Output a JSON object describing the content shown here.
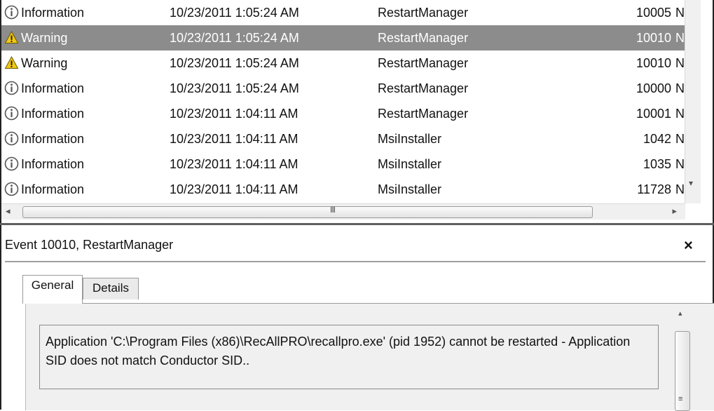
{
  "events": [
    {
      "level": "Information",
      "level_icon": "info-icon",
      "date": "10/23/2011 1:05:24 AM",
      "source": "RestartManager",
      "event_id": "10005",
      "task": "N"
    },
    {
      "level": "Warning",
      "level_icon": "warning-icon",
      "date": "10/23/2011 1:05:24 AM",
      "source": "RestartManager",
      "event_id": "10010",
      "task": "N",
      "selected": true
    },
    {
      "level": "Warning",
      "level_icon": "warning-icon",
      "date": "10/23/2011 1:05:24 AM",
      "source": "RestartManager",
      "event_id": "10010",
      "task": "N"
    },
    {
      "level": "Information",
      "level_icon": "info-icon",
      "date": "10/23/2011 1:05:24 AM",
      "source": "RestartManager",
      "event_id": "10000",
      "task": "N"
    },
    {
      "level": "Information",
      "level_icon": "info-icon",
      "date": "10/23/2011 1:04:11 AM",
      "source": "RestartManager",
      "event_id": "10001",
      "task": "N"
    },
    {
      "level": "Information",
      "level_icon": "info-icon",
      "date": "10/23/2011 1:04:11 AM",
      "source": "MsiInstaller",
      "event_id": "1042",
      "task": "N"
    },
    {
      "level": "Information",
      "level_icon": "info-icon",
      "date": "10/23/2011 1:04:11 AM",
      "source": "MsiInstaller",
      "event_id": "1035",
      "task": "N"
    },
    {
      "level": "Information",
      "level_icon": "info-icon",
      "date": "10/23/2011 1:04:11 AM",
      "source": "MsiInstaller",
      "event_id": "11728",
      "task": "N"
    }
  ],
  "detail": {
    "title": "Event 10010, RestartManager",
    "close_icon": "×",
    "tabs": [
      {
        "label": "General",
        "active": true
      },
      {
        "label": "Details",
        "active": false
      }
    ],
    "message": "Application 'C:\\Program Files (x86)\\RecAllPRO\\recallpro.exe' (pid 1952) cannot be restarted - Application SID does not match Conductor SID.."
  },
  "scrollbar": {
    "arrow_left": "◂",
    "arrow_right": "▸",
    "arrow_down": "▾",
    "arrow_up": "▴",
    "h_grip": "III",
    "v_grip": "≡"
  },
  "colors": {
    "selected_row": "#8c8c8c",
    "info_icon": "#555555",
    "warning_icon": "#f2c811"
  }
}
